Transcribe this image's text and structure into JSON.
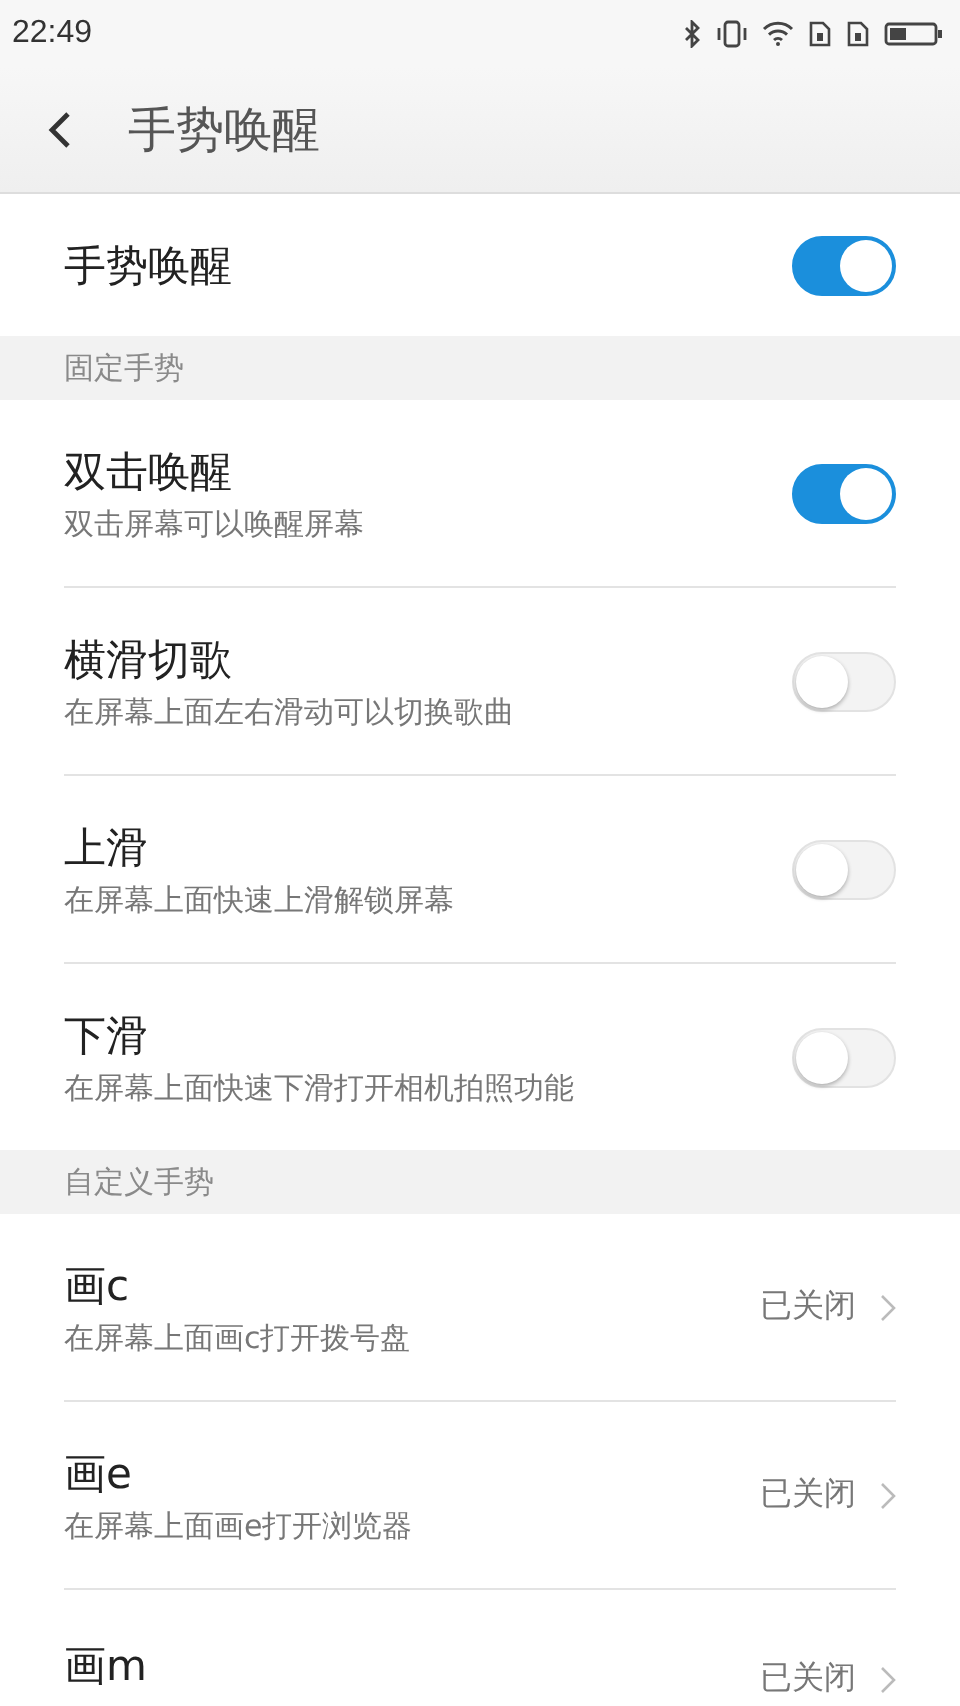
{
  "status_bar": {
    "time": "22:49"
  },
  "header": {
    "title": "手势唤醒"
  },
  "main_toggle": {
    "label": "手势唤醒",
    "on": true
  },
  "sections": [
    {
      "title": "固定手势",
      "items": [
        {
          "kind": "toggle",
          "title": "双击唤醒",
          "subtitle": "双击屏幕可以唤醒屏幕",
          "on": true
        },
        {
          "kind": "toggle",
          "title": "横滑切歌",
          "subtitle": "在屏幕上面左右滑动可以切换歌曲",
          "on": false
        },
        {
          "kind": "toggle",
          "title": "上滑",
          "subtitle": "在屏幕上面快速上滑解锁屏幕",
          "on": false
        },
        {
          "kind": "toggle",
          "title": "下滑",
          "subtitle": "在屏幕上面快速下滑打开相机拍照功能",
          "on": false
        }
      ]
    },
    {
      "title": "自定义手势",
      "items": [
        {
          "kind": "link",
          "title": "画c",
          "subtitle": "在屏幕上面画c打开拨号盘",
          "value": "已关闭"
        },
        {
          "kind": "link",
          "title": "画e",
          "subtitle": "在屏幕上面画e打开浏览器",
          "value": "已关闭"
        },
        {
          "kind": "link",
          "title": "画m",
          "value": "已关闭"
        }
      ]
    }
  ]
}
